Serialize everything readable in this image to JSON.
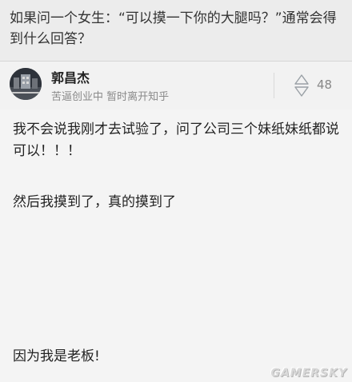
{
  "question": {
    "title": "如果问一个女生：“可以摸一下你的大腿吗？”通常会得到什么回答？"
  },
  "author": {
    "name": "郭昌杰",
    "bio": "苦逼创业中 暂时离开知乎",
    "avatar_icon": "avatar-image"
  },
  "vote": {
    "icon": "vote-arrows-icon",
    "count": "48"
  },
  "answer": {
    "paragraphs": [
      "我不会说我刚才去试验了，问了公司三个妹纸妹纸都说可以！！！",
      "然后我摸到了，真的摸到了",
      "因为我是老板!"
    ]
  },
  "watermark": {
    "text": "GAMERSKY"
  }
}
